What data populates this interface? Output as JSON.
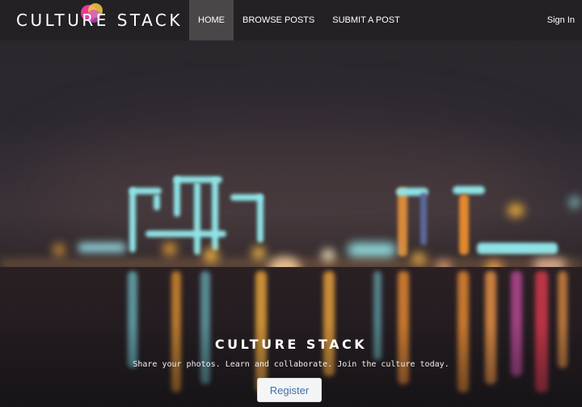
{
  "navbar": {
    "brand": "CULTURE STACK",
    "links": [
      {
        "label": "HOME",
        "active": true
      },
      {
        "label": "BROWSE POSTS",
        "active": false
      },
      {
        "label": "SUBMIT A POST",
        "active": false
      }
    ],
    "signin_label": "Sign In"
  },
  "hero": {
    "title": "CULTURE STACK",
    "subtitle": "Share your photos. Learn and collaborate. Join the culture today.",
    "register_label": "Register"
  },
  "colors": {
    "nav_active_bg": "#4a4749",
    "button_text": "#3f72a6",
    "logo_pink": "#e43d96",
    "logo_yellow": "#f6c84a"
  }
}
